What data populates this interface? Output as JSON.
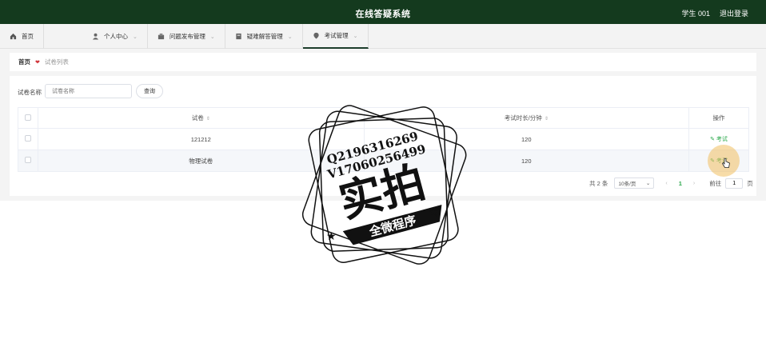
{
  "header": {
    "title": "在线答疑系统",
    "user": "学生 001",
    "logout": "退出登录"
  },
  "nav": [
    {
      "label": "首页",
      "icon": "home-icon"
    },
    {
      "label": "个人中心",
      "icon": "user-icon"
    },
    {
      "label": "问题发布管理",
      "icon": "question-icon"
    },
    {
      "label": "疑难解答管理",
      "icon": "answer-icon"
    },
    {
      "label": "考试管理",
      "icon": "exam-icon",
      "active": true
    }
  ],
  "breadcrumb": {
    "home": "首页",
    "current": "试卷列表"
  },
  "search": {
    "label": "试卷名称",
    "placeholder": "试卷名称",
    "button": "查询"
  },
  "table": {
    "columns": [
      "试卷",
      "考试时长/分钟",
      "操作"
    ],
    "rows": [
      {
        "name": "121212",
        "duration": "120",
        "action": "考试"
      },
      {
        "name": "物理试卷",
        "duration": "120",
        "action": "考试"
      }
    ]
  },
  "pagination": {
    "total": "共 2 条",
    "page_size": "10条/页",
    "current_page": "1",
    "goto_label": "前往",
    "goto_value": "1",
    "page_suffix": "页"
  },
  "watermark": {
    "line1": "Q2196316269",
    "line2": "V17060256499",
    "big": "实拍",
    "banner": "全微程序"
  },
  "colors": {
    "header_bg": "#143a1e",
    "accent": "#2aa84a"
  }
}
